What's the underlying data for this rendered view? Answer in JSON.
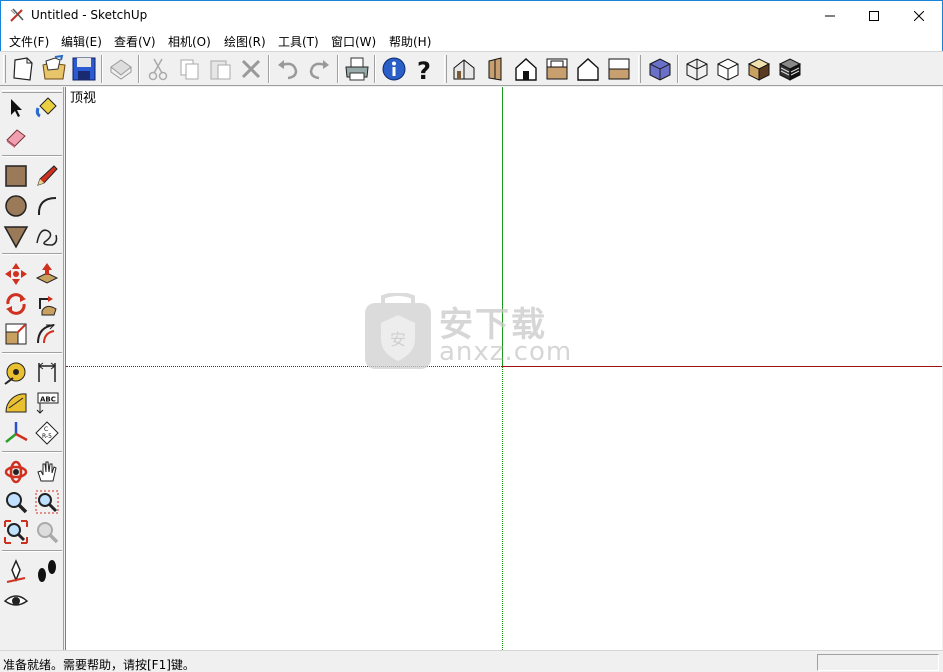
{
  "window": {
    "title": "Untitled - SketchUp",
    "accent_color": "#1883d7"
  },
  "menubar": {
    "items": [
      {
        "label": "文件(F)"
      },
      {
        "label": "编辑(E)"
      },
      {
        "label": "查看(V)"
      },
      {
        "label": "相机(O)"
      },
      {
        "label": "绘图(R)"
      },
      {
        "label": "工具(T)"
      },
      {
        "label": "窗口(W)"
      },
      {
        "label": "帮助(H)"
      }
    ]
  },
  "toolbar": {
    "icons": [
      "new-icon",
      "open-icon",
      "save-icon",
      "make-component-icon",
      "cut-icon",
      "copy-icon",
      "paste-icon",
      "erase-icon",
      "undo-icon",
      "redo-icon",
      "print-icon",
      "model-info-icon",
      "help-icon",
      "iso-view-icon",
      "front-view-icon",
      "top-view-icon",
      "right-view-icon",
      "back-view-icon",
      "left-view-icon",
      "xray-icon",
      "wireframe-icon",
      "hidden-line-icon",
      "shaded-icon",
      "shaded-texture-icon"
    ]
  },
  "left_toolbar": {
    "icons": [
      "select-icon",
      "paint-bucket-icon",
      "eraser-icon",
      "rectangle-icon",
      "pencil-icon",
      "circle-icon",
      "arc-icon",
      "polygon-icon",
      "freehand-icon",
      "move-icon",
      "push-pull-icon",
      "rotate-icon",
      "follow-me-icon",
      "scale-icon",
      "offset-icon",
      "tape-measure-icon",
      "dimension-icon",
      "protractor-icon",
      "text-icon",
      "axes-icon",
      "3d-text-icon",
      "orbit-icon",
      "pan-icon",
      "zoom-icon",
      "zoom-window-icon",
      "zoom-extents-icon",
      "previous-view-icon",
      "position-camera-icon",
      "walk-icon",
      "look-around-icon"
    ]
  },
  "canvas": {
    "view_label": "顶视",
    "axis_colors": {
      "green": "#1a9a1a",
      "red": "#a01010"
    },
    "watermark": {
      "text": "安下载",
      "sub": "anxz.com"
    }
  },
  "statusbar": {
    "text": "准备就绪。需要帮助，请按[F1]键。",
    "measurement_value": ""
  }
}
